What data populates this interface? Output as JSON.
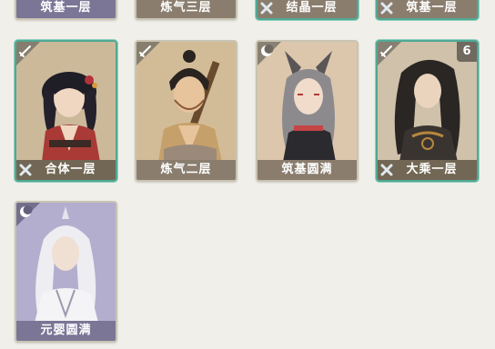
{
  "top_row_partial": [
    {
      "name": "筑基一层",
      "selected": false,
      "has_x": false,
      "palette": "purple"
    },
    {
      "name": "炼气三层",
      "selected": false,
      "has_x": false,
      "palette": "tan"
    },
    {
      "name": "结晶一层",
      "selected": true,
      "has_x": true,
      "palette": "tan"
    },
    {
      "name": "筑基一层",
      "selected": true,
      "has_x": true,
      "palette": "tan"
    }
  ],
  "cards": [
    {
      "name": "合体一层",
      "selected": true,
      "has_x": true,
      "corner_icon": "sword-icon"
    },
    {
      "name": "炼气二层",
      "selected": false,
      "has_x": false,
      "corner_icon": "sword-icon"
    },
    {
      "name": "筑基圆满",
      "selected": false,
      "has_x": false,
      "corner_icon": "crescent-icon"
    },
    {
      "name": "大乘一层",
      "selected": true,
      "has_x": true,
      "corner_icon": "sword-icon",
      "count": "6"
    },
    {
      "name": "元婴圆满",
      "selected": false,
      "has_x": false,
      "corner_icon": "crescent-icon"
    }
  ]
}
